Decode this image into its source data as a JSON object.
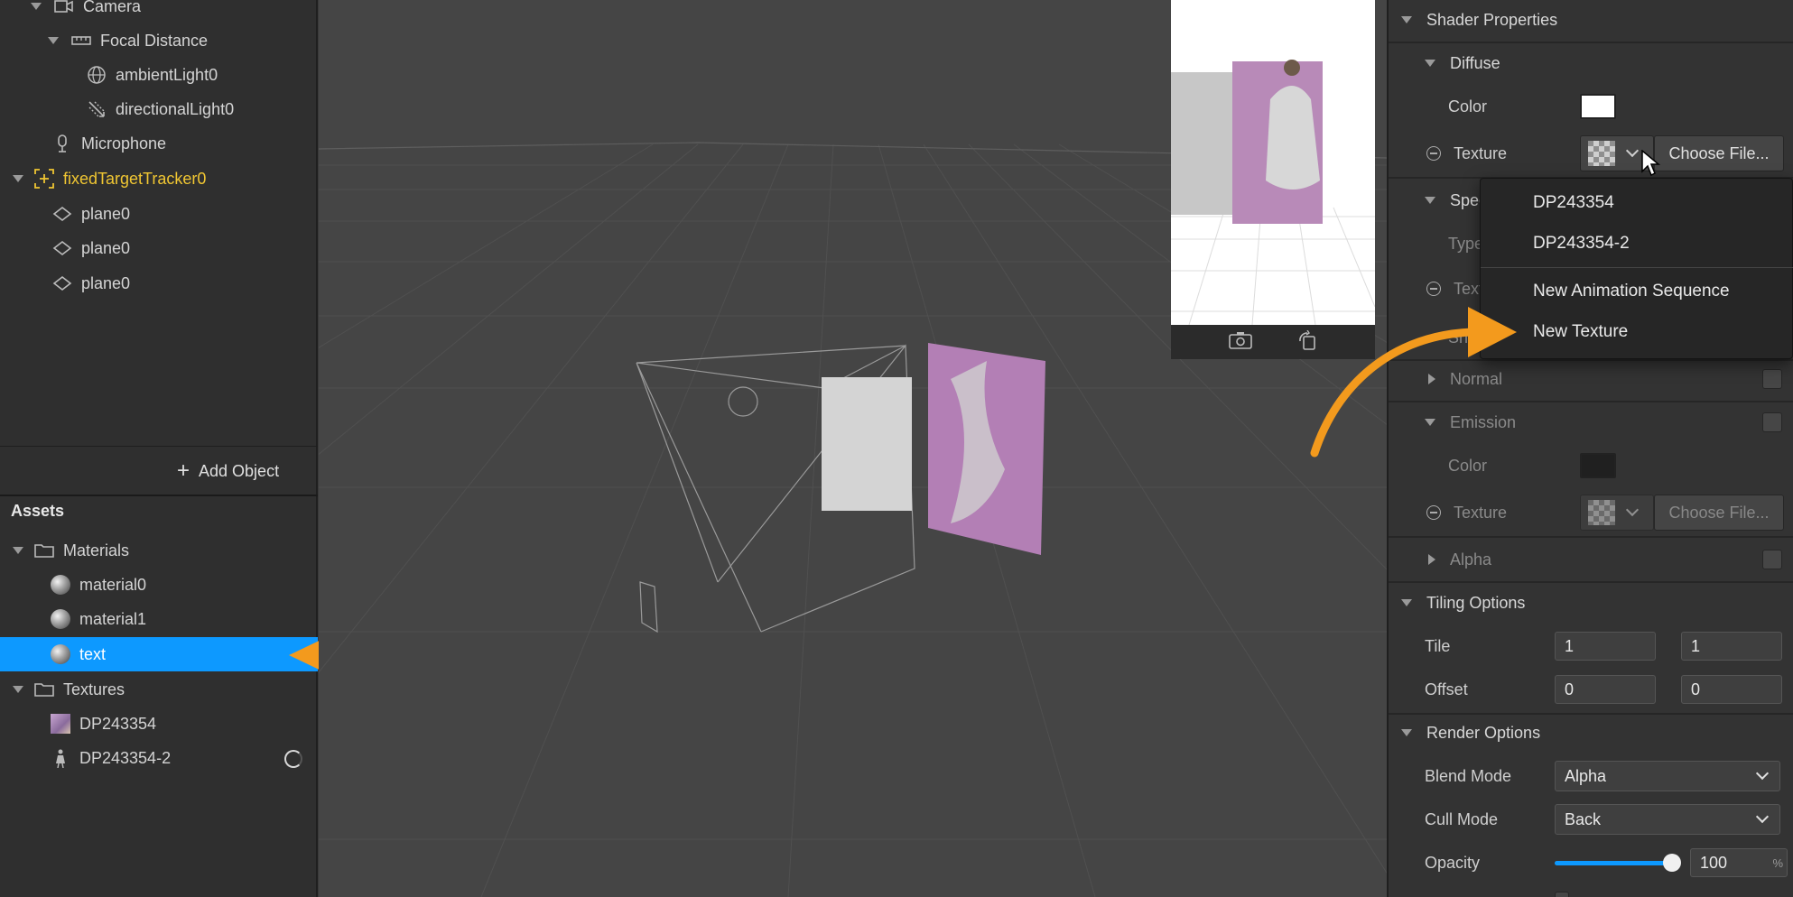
{
  "scene_tree": {
    "items": [
      {
        "label": "Camera"
      },
      {
        "label": "Focal Distance"
      },
      {
        "label": "ambientLight0"
      },
      {
        "label": "directionalLight0"
      },
      {
        "label": "Microphone"
      },
      {
        "label": "fixedTargetTracker0"
      },
      {
        "label": "plane0"
      },
      {
        "label": "plane0"
      },
      {
        "label": "plane0"
      }
    ],
    "add_object_label": "Add Object"
  },
  "assets": {
    "title": "Assets",
    "materials_folder": "Materials",
    "materials": [
      "material0",
      "material1",
      "text"
    ],
    "selected": "text",
    "textures_folder": "Textures",
    "textures": [
      "DP243354",
      "DP243354-2"
    ]
  },
  "shader": {
    "title": "Shader Properties",
    "diffuse": {
      "title": "Diffuse",
      "color_label": "Color",
      "color_value": "#ffffff",
      "texture_label": "Texture",
      "choose_file": "Choose File..."
    },
    "specular": {
      "title_partial": "Spec",
      "type_partial": "Type",
      "texture_partial": "Text",
      "shin_partial": "Shi"
    },
    "normal": {
      "title": "Normal"
    },
    "emission": {
      "title": "Emission",
      "color_label": "Color",
      "color_value": "#202020",
      "texture_label": "Texture",
      "choose_file": "Choose File..."
    },
    "alpha": {
      "title": "Alpha"
    }
  },
  "tiling": {
    "title": "Tiling Options",
    "tile_label": "Tile",
    "tile_x": "1",
    "tile_y": "1",
    "offset_label": "Offset",
    "offset_x": "0",
    "offset_y": "0"
  },
  "render": {
    "title": "Render Options",
    "blend_label": "Blend Mode",
    "blend_value": "Alpha",
    "cull_label": "Cull Mode",
    "cull_value": "Back",
    "opacity_label": "Opacity",
    "opacity_value": "100",
    "opacity_unit": "%",
    "opacity_fraction": 1.0
  },
  "texture_menu": {
    "items": [
      "DP243354",
      "DP243354-2",
      "New Animation Sequence",
      "New Texture"
    ]
  },
  "colors": {
    "selection": "#0d99ff",
    "tracker": "#f0c632",
    "annotation_arrow": "#f39a1d"
  }
}
